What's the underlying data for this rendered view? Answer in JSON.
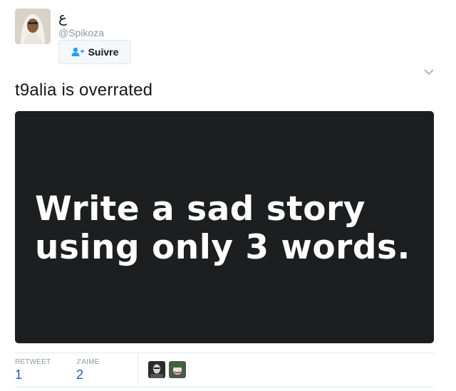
{
  "user": {
    "display_name": "ع",
    "handle": "@Spikoza",
    "avatar_icon": "user-avatar"
  },
  "follow_button": {
    "label": "Suivre",
    "icon": "add-user-icon",
    "icon_color": "#1da1f2"
  },
  "menu_icon": "chevron-down-icon",
  "tweet": {
    "text": "t9alia is overrated"
  },
  "media": {
    "lines": [
      "Write a sad story",
      "using only 3 words."
    ],
    "background": "#1d1e20"
  },
  "stats": {
    "retweets_label": "RETWEET",
    "retweets_value": "1",
    "likes_label": "J'AIME",
    "likes_value": "2",
    "value_color": "#1d5fb6"
  },
  "likers": [
    {
      "icon": "liker-avatar-1"
    },
    {
      "icon": "liker-avatar-2"
    }
  ]
}
